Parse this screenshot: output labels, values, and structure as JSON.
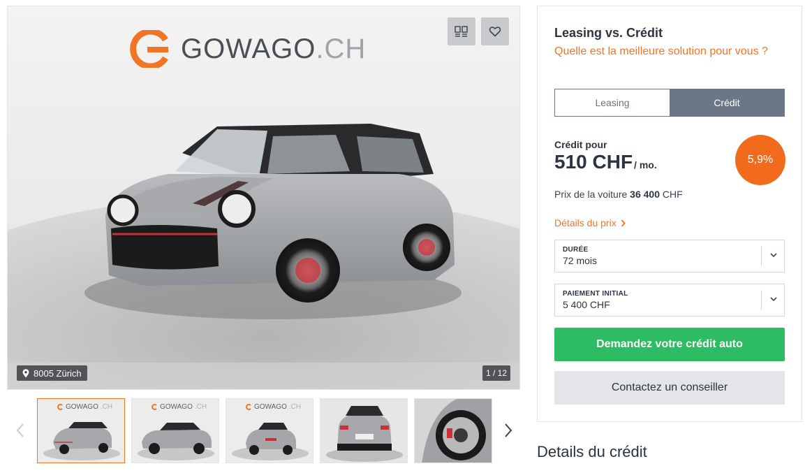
{
  "gallery": {
    "logo_main": "GOWAGO",
    "logo_suffix": ".CH",
    "location": "8005 Zürich",
    "counter": "1 / 12",
    "icons": [
      "compare-icon",
      "heart-icon",
      "map-pin-icon",
      "chevron-left-icon",
      "chevron-right-icon"
    ],
    "thumb_logo_main": "GOWAGO",
    "thumb_logo_suffix": ".CH"
  },
  "panel": {
    "title": "Leasing vs. Crédit",
    "subtitle": "Quelle est la meilleure solution pour vous ?",
    "toggle": {
      "leasing": "Leasing",
      "credit": "Crédit",
      "selected": "Crédit"
    },
    "credit_label": "Crédit pour",
    "amount": "510 CHF",
    "amount_unit": "/ mo.",
    "rate": "5,9%",
    "car_price_label": "Prix de la voiture",
    "car_price_value": "36 400",
    "car_price_currency": "CHF",
    "price_details_link": "Détails du prix",
    "duration": {
      "label": "DURÉE",
      "value": "72 mois"
    },
    "down_payment": {
      "label": "PAIEMENT INITIAL",
      "value": "5 400 CHF"
    },
    "cta_primary": "Demandez votre crédit auto",
    "cta_secondary": "Contactez un conseiller"
  },
  "section_title": "Details du crédit",
  "colors": {
    "brand_orange": "#f07524",
    "primary_green": "#2dbb63",
    "toggle_active": "#6b7785",
    "text_dark": "#2c3440"
  }
}
